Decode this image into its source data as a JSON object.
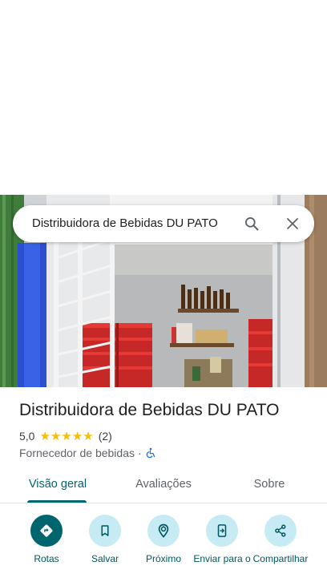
{
  "search": {
    "query": "Distribuidora de Bebidas DU PATO"
  },
  "place": {
    "title": "Distribuidora de Bebidas DU PATO",
    "rating": "5,0",
    "stars": [
      "★",
      "★",
      "★",
      "★",
      "★"
    ],
    "reviews": "(2)",
    "category": "Fornecedor de bebidas",
    "separator": "·"
  },
  "tabs": [
    {
      "label": "Visão geral",
      "active": true
    },
    {
      "label": "Avaliações",
      "active": false
    },
    {
      "label": "Sobre",
      "active": false
    }
  ],
  "actions": [
    {
      "label": "Rotas",
      "icon": "directions-icon"
    },
    {
      "label": "Salvar",
      "icon": "bookmark-icon"
    },
    {
      "label": "Próximo",
      "icon": "nearby-icon"
    },
    {
      "label": "Enviar para o",
      "icon": "send-to-phone-icon"
    },
    {
      "label": "Compartilhar",
      "icon": "share-icon"
    }
  ],
  "colors": {
    "accent": "#00666d",
    "accent_light": "#c6ebf4",
    "star": "#fbbc04",
    "access_icon": "#1a73e8"
  }
}
